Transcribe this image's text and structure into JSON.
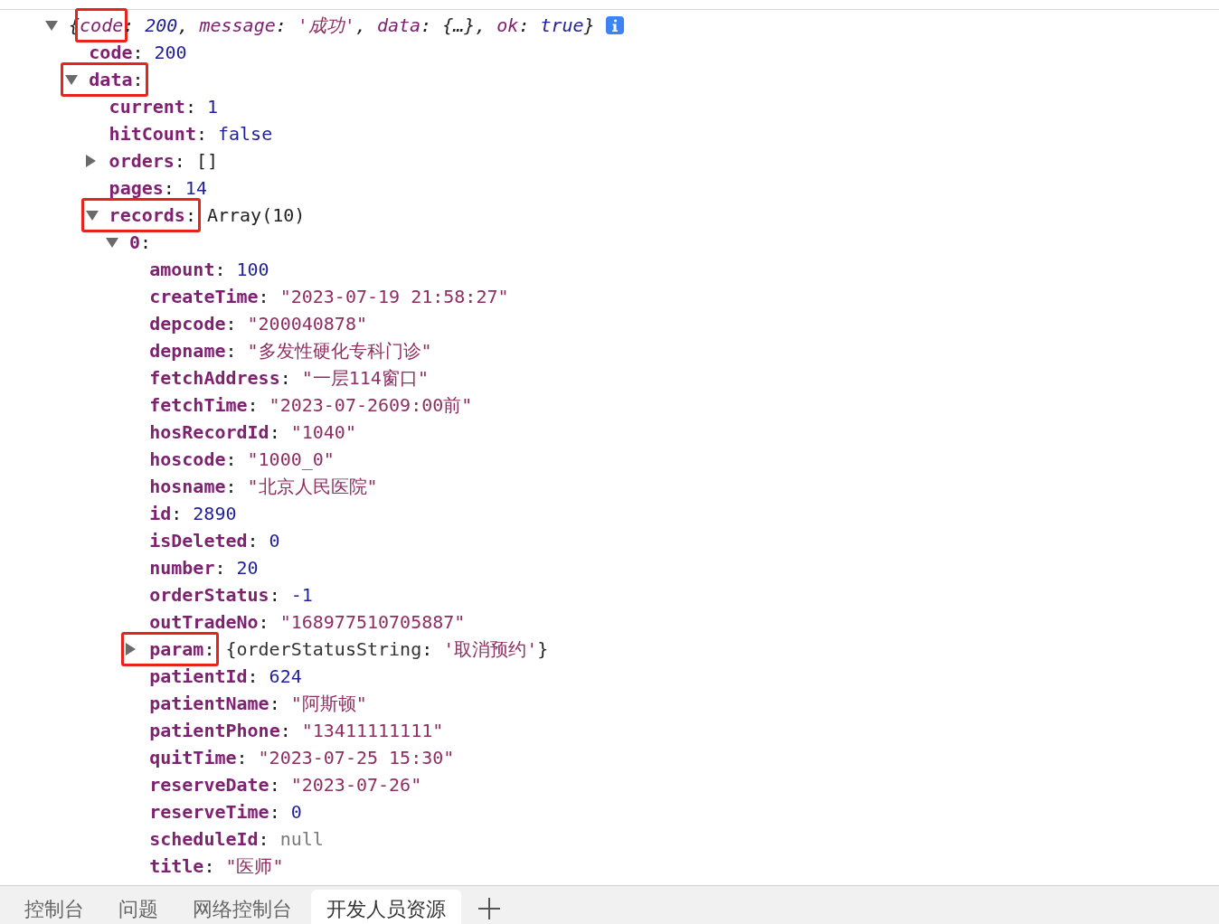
{
  "punctuation": {
    "colon": ":",
    "comma": ","
  },
  "tree": {
    "kind": "node",
    "expanded": true,
    "highlighted": false,
    "preview": {
      "open": "{",
      "close": "}",
      "entries": [
        {
          "key": "code",
          "value": "200",
          "kind": "number",
          "highlighted": true
        },
        {
          "key": "message",
          "value": "'成功'",
          "kind": "string",
          "highlighted": false
        },
        {
          "key": "data",
          "value": "{…}",
          "kind": "plain",
          "highlighted": false
        },
        {
          "key": "ok",
          "value": "true",
          "kind": "boolean",
          "highlighted": false
        }
      ]
    },
    "children": [
      {
        "key": "code",
        "value": "200",
        "kind": "number",
        "highlighted": false
      },
      {
        "key": "data",
        "kind": "node",
        "expanded": true,
        "highlighted": true,
        "children": [
          {
            "key": "current",
            "value": "1",
            "kind": "number",
            "highlighted": false
          },
          {
            "key": "hitCount",
            "value": "false",
            "kind": "boolean",
            "highlighted": false
          },
          {
            "key": "orders",
            "value": "[]",
            "kind": "node",
            "expanded": false,
            "highlighted": false
          },
          {
            "key": "pages",
            "value": "14",
            "kind": "number",
            "highlighted": false
          },
          {
            "key": "records",
            "value": "Array(10)",
            "kind": "node",
            "expanded": true,
            "highlighted": true,
            "children": [
              {
                "key": "0",
                "kind": "node",
                "expanded": true,
                "highlighted": false,
                "children": [
                  {
                    "key": "amount",
                    "value": "100",
                    "kind": "number",
                    "highlighted": false
                  },
                  {
                    "key": "createTime",
                    "value": "\"2023-07-19 21:58:27\"",
                    "kind": "string",
                    "highlighted": false
                  },
                  {
                    "key": "depcode",
                    "value": "\"200040878\"",
                    "kind": "string",
                    "highlighted": false
                  },
                  {
                    "key": "depname",
                    "value": "\"多发性硬化专科门诊\"",
                    "kind": "string",
                    "highlighted": false
                  },
                  {
                    "key": "fetchAddress",
                    "value": "\"一层114窗口\"",
                    "kind": "string",
                    "highlighted": false
                  },
                  {
                    "key": "fetchTime",
                    "value": "\"2023-07-2609:00前\"",
                    "kind": "string",
                    "highlighted": false
                  },
                  {
                    "key": "hosRecordId",
                    "value": "\"1040\"",
                    "kind": "string",
                    "highlighted": false
                  },
                  {
                    "key": "hoscode",
                    "value": "\"1000_0\"",
                    "kind": "string",
                    "highlighted": false
                  },
                  {
                    "key": "hosname",
                    "value": "\"北京人民医院\"",
                    "kind": "string",
                    "highlighted": false
                  },
                  {
                    "key": "id",
                    "value": "2890",
                    "kind": "number",
                    "highlighted": false
                  },
                  {
                    "key": "isDeleted",
                    "value": "0",
                    "kind": "number",
                    "highlighted": false
                  },
                  {
                    "key": "number",
                    "value": "20",
                    "kind": "number",
                    "highlighted": false
                  },
                  {
                    "key": "orderStatus",
                    "value": "-1",
                    "kind": "number",
                    "highlighted": false
                  },
                  {
                    "key": "outTradeNo",
                    "value": "\"168977510705887\"",
                    "kind": "string",
                    "highlighted": false
                  },
                  {
                    "key": "param",
                    "kind": "node",
                    "expanded": false,
                    "highlighted": true,
                    "preview": {
                      "open": "{",
                      "close": "}",
                      "entries": [
                        {
                          "key": "orderStatusString",
                          "value": "'取消预约'",
                          "kind": "string",
                          "highlighted": false
                        }
                      ]
                    }
                  },
                  {
                    "key": "patientId",
                    "value": "624",
                    "kind": "number",
                    "highlighted": false
                  },
                  {
                    "key": "patientName",
                    "value": "\"阿斯顿\"",
                    "kind": "string",
                    "highlighted": false
                  },
                  {
                    "key": "patientPhone",
                    "value": "\"13411111111\"",
                    "kind": "string",
                    "highlighted": false
                  },
                  {
                    "key": "quitTime",
                    "value": "\"2023-07-25 15:30\"",
                    "kind": "string",
                    "highlighted": false
                  },
                  {
                    "key": "reserveDate",
                    "value": "\"2023-07-26\"",
                    "kind": "string",
                    "highlighted": false
                  },
                  {
                    "key": "reserveTime",
                    "value": "0",
                    "kind": "number",
                    "highlighted": false
                  },
                  {
                    "key": "scheduleId",
                    "value": "null",
                    "kind": "null",
                    "highlighted": false
                  },
                  {
                    "key": "title",
                    "value": "\"医师\"",
                    "kind": "string",
                    "highlighted": false
                  }
                ]
              }
            ]
          }
        ]
      }
    ]
  },
  "tabs": [
    {
      "label": "控制台",
      "selected": false
    },
    {
      "label": "问题",
      "selected": false
    },
    {
      "label": "网络控制台",
      "selected": false
    },
    {
      "label": "开发人员资源",
      "selected": true
    }
  ]
}
